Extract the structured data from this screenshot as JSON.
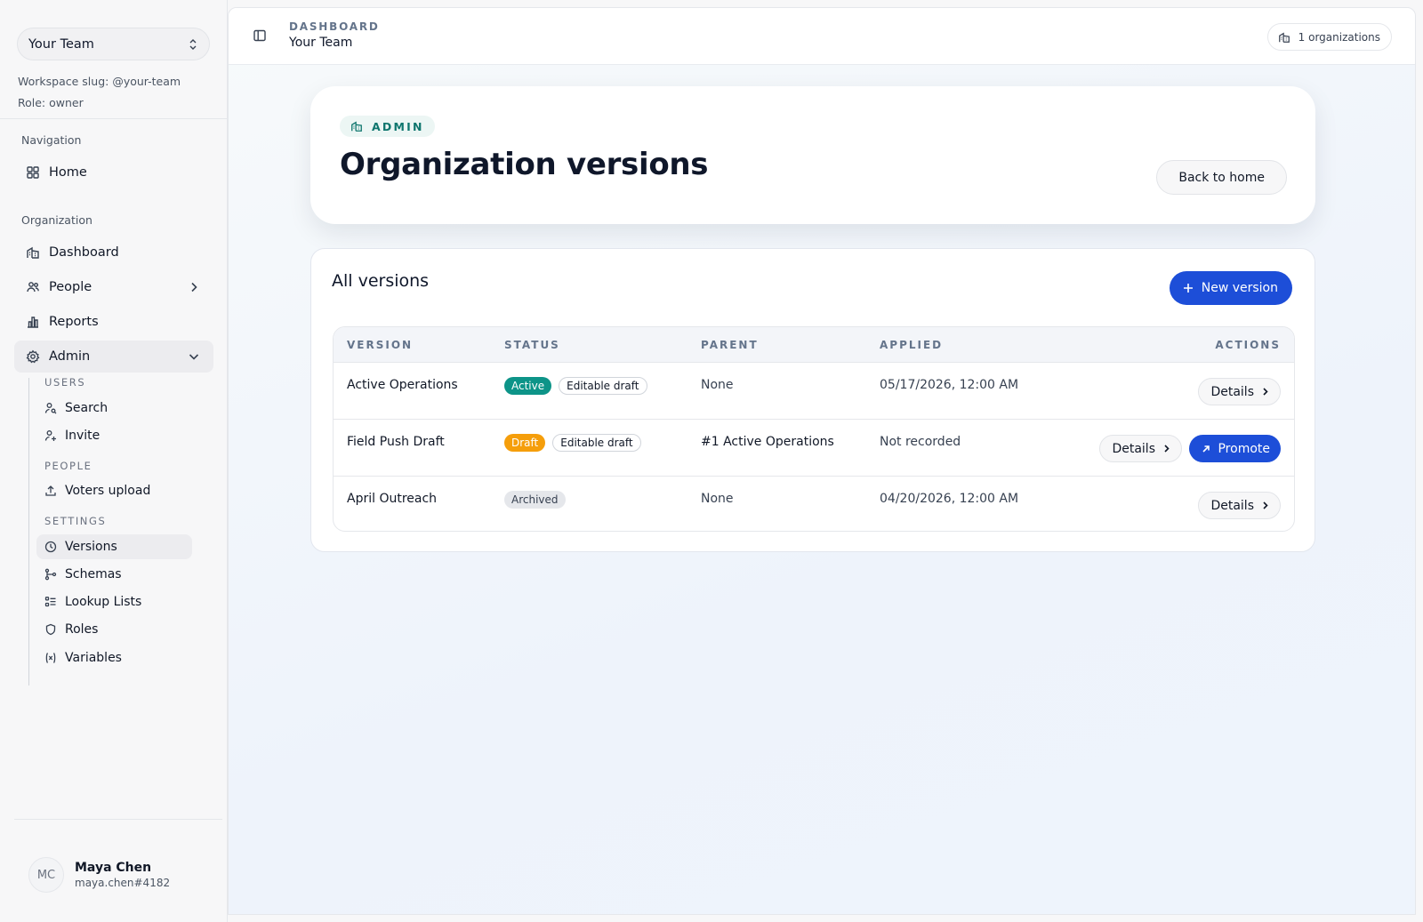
{
  "sidebar": {
    "team_select": "Your Team",
    "workspace_slug": "Workspace slug: @your-team",
    "role": "Role: owner",
    "nav_section": "Navigation",
    "home": "Home",
    "org_section": "Organization",
    "dashboard": "Dashboard",
    "people": "People",
    "reports": "Reports",
    "admin": "Admin",
    "admin_groups": {
      "users_label": "USERS",
      "search": "Search",
      "invite": "Invite",
      "people_label": "PEOPLE",
      "voters_upload": "Voters upload",
      "settings_label": "SETTINGS",
      "versions": "Versions",
      "schemas": "Schemas",
      "lookup_lists": "Lookup Lists",
      "roles": "Roles",
      "variables": "Variables"
    },
    "user": {
      "initials": "MC",
      "name": "Maya Chen",
      "handle": "maya.chen#4182"
    }
  },
  "topbar": {
    "breadcrumb_section": "DASHBOARD",
    "breadcrumb_page": "Your Team",
    "org_count": "1 organizations"
  },
  "hero": {
    "tag": "ADMIN",
    "title": "Organization versions",
    "back_button": "Back to home"
  },
  "versions_card": {
    "title": "All versions",
    "new_button": "New version",
    "columns": {
      "version": "VERSION",
      "status": "STATUS",
      "parent": "PARENT",
      "applied": "APPLIED",
      "actions": "ACTIONS"
    },
    "rows": [
      {
        "name": "Active Operations",
        "status": "Active",
        "status_color": "#0d9488",
        "flag": "Editable draft",
        "parent": "None",
        "applied": "05/17/2026, 12:00 AM",
        "details": "Details"
      },
      {
        "name": "Field Push Draft",
        "status": "Draft",
        "status_color": "#f59e0b",
        "flag": "Editable draft",
        "parent": "#1 Active Operations",
        "applied": "Not recorded",
        "details": "Details",
        "promote": "Promote"
      },
      {
        "name": "April Outreach",
        "status": "Archived",
        "status_color": "#e5e7eb",
        "parent": "None",
        "applied": "04/20/2026, 12:00 AM",
        "details": "Details"
      }
    ]
  },
  "colors": {
    "primary": "#1d4ed8",
    "accent_teal": "#0f766e",
    "draft_amber": "#f59e0b"
  }
}
